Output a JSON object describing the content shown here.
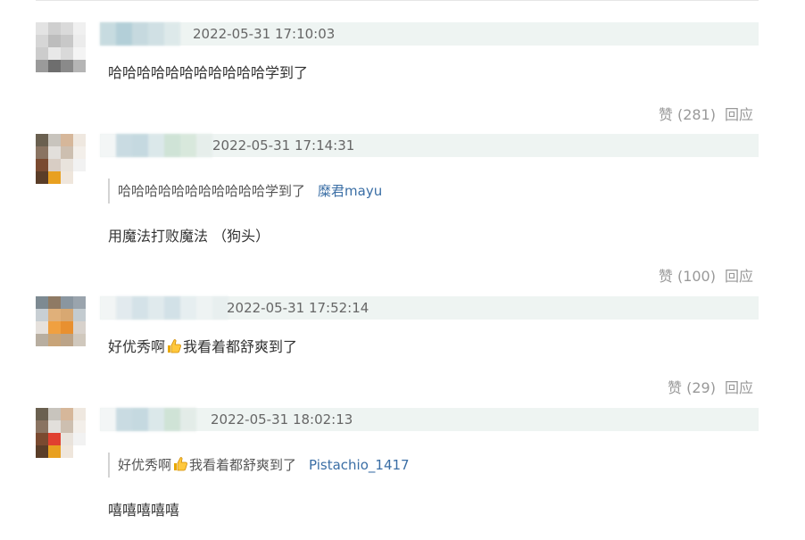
{
  "comments": [
    {
      "timestamp": "2022-05-31 17:10:03",
      "text": "哈哈哈哈哈哈哈哈哈哈哈学到了",
      "like_label": "赞 (281)",
      "reply_label": "回应"
    },
    {
      "timestamp": "2022-05-31 17:14:31",
      "quote_text": "哈哈哈哈哈哈哈哈哈哈哈学到了",
      "quote_author": "糜君mayu",
      "text": "用魔法打败魔法 （狗头）",
      "like_label": "赞 (100)",
      "reply_label": "回应"
    },
    {
      "timestamp": "2022-05-31 17:52:14",
      "text_before": "好优秀啊",
      "text_after": "我看着都舒爽到了",
      "like_label": "赞 (29)",
      "reply_label": "回应"
    },
    {
      "timestamp": "2022-05-31 18:02:13",
      "quote_text_before": "好优秀啊",
      "quote_text_after": "我看着都舒爽到了",
      "quote_author": "Pistachio_1417",
      "text": "嘻嘻嘻嘻嘻"
    }
  ],
  "icons": {
    "thumbs_up": "thumbs-up-icon"
  },
  "colors": {
    "meta_bar": "#eef4f2",
    "author_link": "#3a6ea5",
    "muted": "#999999"
  }
}
